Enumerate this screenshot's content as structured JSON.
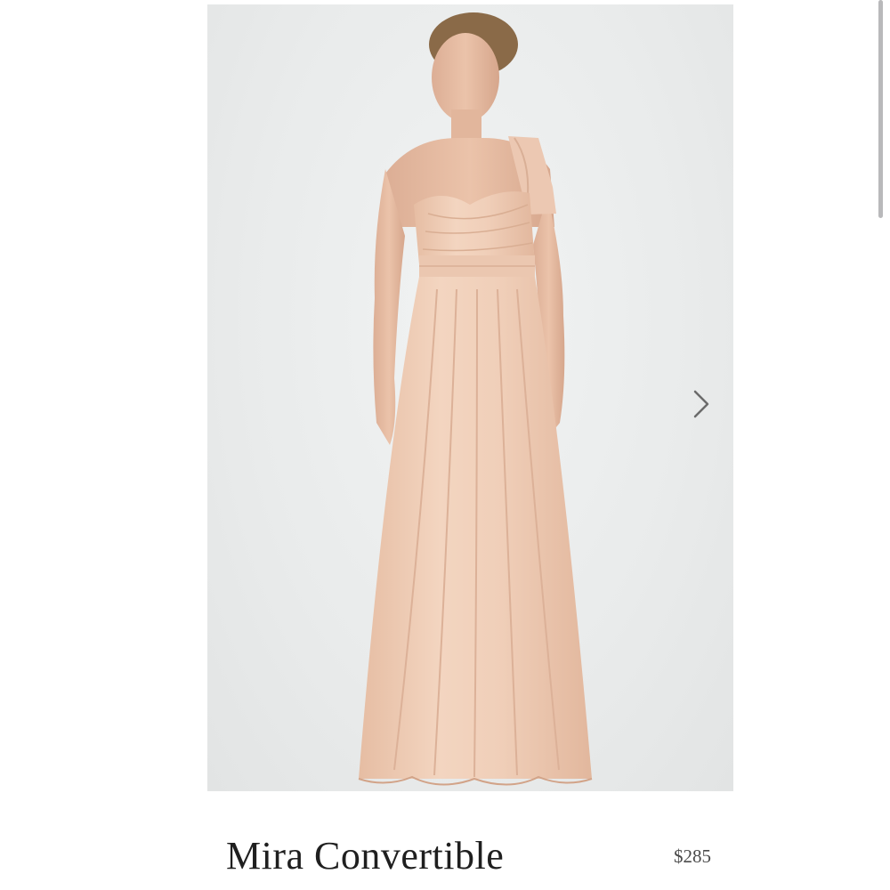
{
  "product": {
    "name": "Mira Convertible",
    "price": "$285"
  },
  "gallery": {
    "next_icon": "chevron-right-icon",
    "image_subject": "model-in-blush-gown"
  },
  "colors": {
    "dress": "#f1d2bd",
    "background": "#eceeee",
    "title_text": "#1f1f1f",
    "price_text": "#4a4a4a",
    "arrow": "#6b6b6b"
  }
}
